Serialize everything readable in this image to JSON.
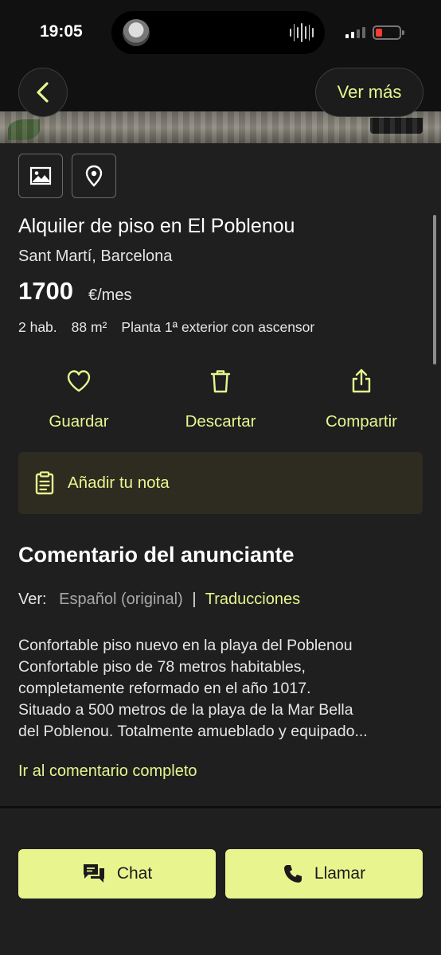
{
  "status_bar": {
    "time": "19:05"
  },
  "nav": {
    "back_icon": "chevron-left-icon",
    "ver_mas": "Ver más"
  },
  "media": {
    "photos_icon": "image-icon",
    "map_icon": "location-pin-icon"
  },
  "listing": {
    "title": "Alquiler de piso en El Poblenou",
    "location": "Sant Martí, Barcelona",
    "price": "1700",
    "price_unit": "€/mes",
    "features": [
      "2 hab.",
      "88 m²",
      "Planta 1ª exterior con ascensor"
    ]
  },
  "actions": [
    {
      "label": "Guardar",
      "icon": "heart-icon"
    },
    {
      "label": "Descartar",
      "icon": "trash-icon"
    },
    {
      "label": "Compartir",
      "icon": "share-icon"
    }
  ],
  "note": {
    "label": "Añadir tu nota",
    "icon": "clipboard-icon"
  },
  "comment_section": {
    "title": "Comentario del anunciante",
    "ver_label": "Ver:",
    "original": "Español (original)",
    "separator": "|",
    "translations": "Traducciones",
    "lines": [
      "Confortable piso nuevo en la playa del Poblenou",
      "Confortable piso de 78 metros habitables,",
      "completamente reformado en el año 1017.",
      "Situado a 500 metros de la playa de la Mar Bella",
      "del Poblenou. Totalmente amueblado y equipado..."
    ],
    "full_link": "Ir al comentario completo"
  },
  "bottom": {
    "chat": "Chat",
    "call": "Llamar"
  },
  "colors": {
    "accent": "#e8f58f",
    "background": "#1f1f1f",
    "note_bg": "#2e2b21",
    "battery_low": "#ff3b30"
  }
}
